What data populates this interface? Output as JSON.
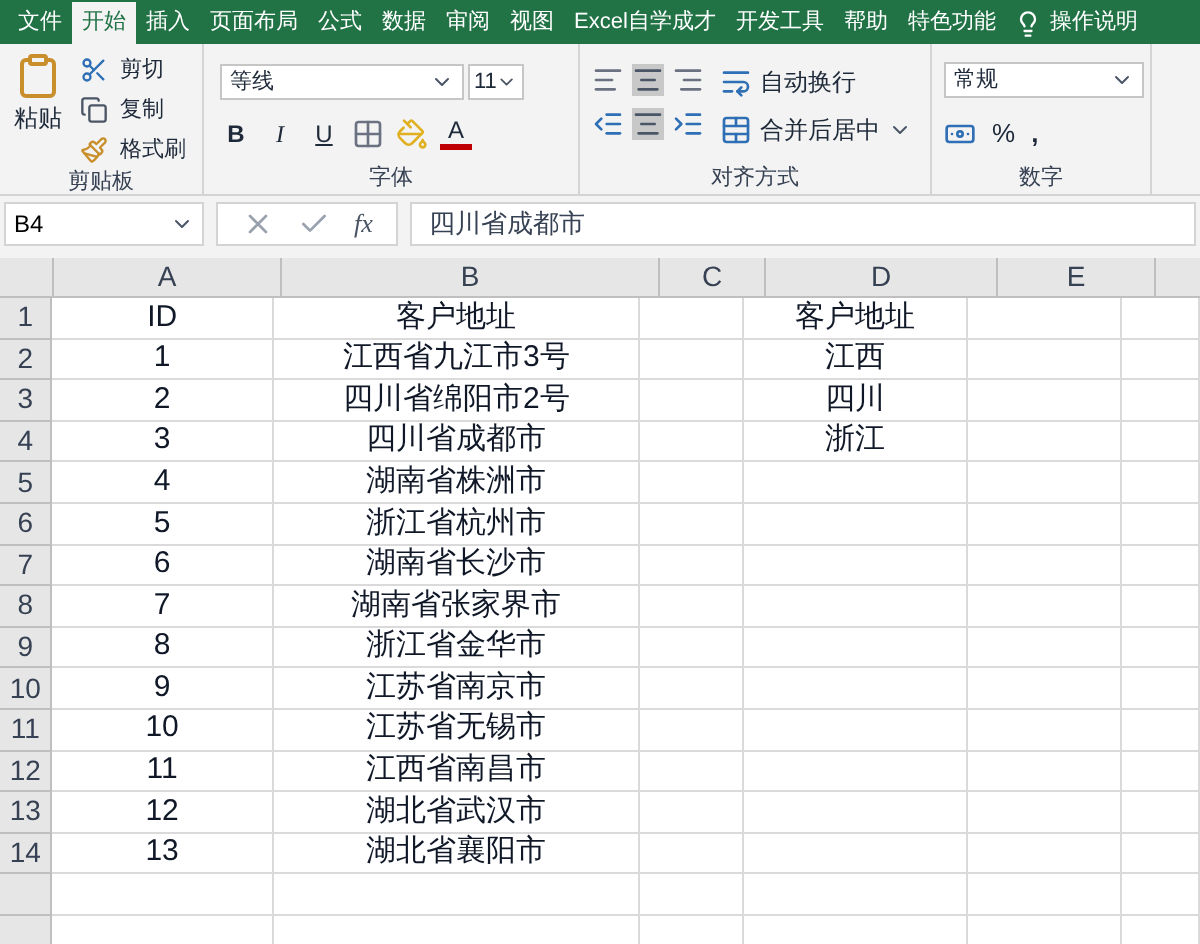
{
  "tabs": [
    {
      "label": "文件",
      "selected": false
    },
    {
      "label": "开始",
      "selected": true
    },
    {
      "label": "插入",
      "selected": false
    },
    {
      "label": "页面布局",
      "selected": false
    },
    {
      "label": "公式",
      "selected": false
    },
    {
      "label": "数据",
      "selected": false
    },
    {
      "label": "审阅",
      "selected": false
    },
    {
      "label": "视图",
      "selected": false
    },
    {
      "label": "Excel自学成才",
      "selected": false
    },
    {
      "label": "开发工具",
      "selected": false
    },
    {
      "label": "帮助",
      "selected": false
    },
    {
      "label": "特色功能",
      "selected": false
    }
  ],
  "tell_me": "操作说明",
  "ribbon": {
    "clipboard": {
      "paste": "粘贴",
      "cut": "剪切",
      "copy": "复制",
      "format_painter": "格式刷",
      "label": "剪贴板"
    },
    "font": {
      "font_name": "等线",
      "font_size": "11",
      "bold": "B",
      "italic": "I",
      "underline": "U",
      "font_color": "A",
      "label": "字体"
    },
    "alignment": {
      "wrap_text": "自动换行",
      "merge_center": "合并后居中",
      "label": "对齐方式"
    },
    "number": {
      "format": "常规",
      "percent": "%",
      "comma": ",",
      "label": "数字"
    }
  },
  "formula_bar": {
    "name_box": "B4",
    "fx": "fx",
    "formula": "四川省成都市"
  },
  "sheet": {
    "columns": [
      "A",
      "B",
      "C",
      "D",
      "E"
    ],
    "rows": [
      {
        "number": "1",
        "cells": [
          "ID",
          "客户地址",
          null,
          "客户地址",
          null
        ]
      },
      {
        "number": "2",
        "cells": [
          "1",
          "江西省九江市3号",
          null,
          "江西",
          null
        ]
      },
      {
        "number": "3",
        "cells": [
          "2",
          "四川省绵阳市2号",
          null,
          "四川",
          null
        ]
      },
      {
        "number": "4",
        "cells": [
          "3",
          "四川省成都市",
          null,
          "浙江",
          null
        ]
      },
      {
        "number": "5",
        "cells": [
          "4",
          "湖南省株洲市",
          null,
          null,
          null
        ]
      },
      {
        "number": "6",
        "cells": [
          "5",
          "浙江省杭州市",
          null,
          null,
          null
        ]
      },
      {
        "number": "7",
        "cells": [
          "6",
          "湖南省长沙市",
          null,
          null,
          null
        ]
      },
      {
        "number": "8",
        "cells": [
          "7",
          "湖南省张家界市",
          null,
          null,
          null
        ]
      },
      {
        "number": "9",
        "cells": [
          "8",
          "浙江省金华市",
          null,
          null,
          null
        ]
      },
      {
        "number": "10",
        "cells": [
          "9",
          "江苏省南京市",
          null,
          null,
          null
        ]
      },
      {
        "number": "11",
        "cells": [
          "10",
          "江苏省无锡市",
          null,
          null,
          null
        ]
      },
      {
        "number": "12",
        "cells": [
          "11",
          "江西省南昌市",
          null,
          null,
          null
        ]
      },
      {
        "number": "13",
        "cells": [
          "12",
          "湖北省武汉市",
          null,
          null,
          null
        ]
      },
      {
        "number": "14",
        "cells": [
          "13",
          "湖北省襄阳市",
          null,
          null,
          null
        ]
      }
    ]
  }
}
